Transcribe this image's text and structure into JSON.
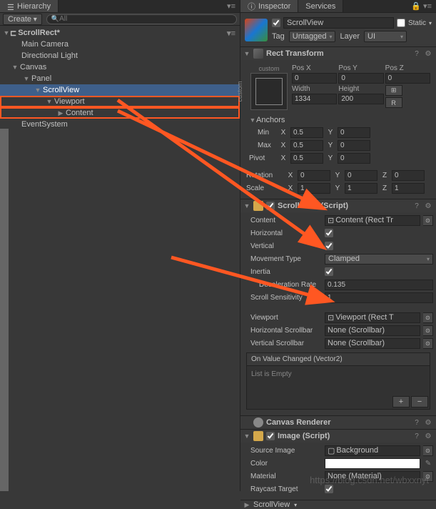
{
  "hierarchy": {
    "tab": "Hierarchy",
    "create": "Create",
    "search_placeholder": "All",
    "scene": "ScrollRect*",
    "items": {
      "main_camera": "Main Camera",
      "directional_light": "Directional Light",
      "canvas": "Canvas",
      "panel": "Panel",
      "scrollview": "ScrollView",
      "viewport": "Viewport",
      "content": "Content",
      "eventsystem": "EventSystem"
    }
  },
  "inspector": {
    "tab": "Inspector",
    "services_tab": "Services",
    "go_name": "ScrollView",
    "static_label": "Static",
    "tag_label": "Tag",
    "tag_value": "Untagged",
    "layer_label": "Layer",
    "layer_value": "UI"
  },
  "rect_transform": {
    "title": "Rect Transform",
    "anchor_preset_top": "custom",
    "anchor_preset_left": "custom",
    "labels": {
      "posx": "Pos X",
      "posy": "Pos Y",
      "posz": "Pos Z",
      "width": "Width",
      "height": "Height"
    },
    "posx": "0",
    "posy": "0",
    "posz": "0",
    "width": "1334",
    "height": "200",
    "blueprint": "⊞",
    "raw": "R",
    "anchors_label": "Anchors",
    "min_label": "Min",
    "max_label": "Max",
    "pivot_label": "Pivot",
    "min_x": "0.5",
    "min_y": "0",
    "max_x": "0.5",
    "max_y": "0",
    "pivot_x": "0.5",
    "pivot_y": "0",
    "rotation_label": "Rotation",
    "scale_label": "Scale",
    "rot_x": "0",
    "rot_y": "0",
    "rot_z": "0",
    "scale_x": "1",
    "scale_y": "1",
    "scale_z": "1"
  },
  "scroll_rect": {
    "title": "Scroll Rect (Script)",
    "content_label": "Content",
    "content_value": "Content (Rect Tr",
    "horizontal_label": "Horizontal",
    "vertical_label": "Vertical",
    "movement_label": "Movement Type",
    "movement_value": "Clamped",
    "inertia_label": "Inertia",
    "decel_label": "Deceleration Rate",
    "decel_value": "0.135",
    "sensitivity_label": "Scroll Sensitivity",
    "sensitivity_value": "1",
    "viewport_label": "Viewport",
    "viewport_value": "Viewport (Rect T",
    "hscroll_label": "Horizontal Scrollbar",
    "hscroll_value": "None (Scrollbar)",
    "vscroll_label": "Vertical Scrollbar",
    "vscroll_value": "None (Scrollbar)",
    "event_title": "On Value Changed (Vector2)",
    "event_empty": "List is Empty"
  },
  "canvas_renderer": {
    "title": "Canvas Renderer"
  },
  "image": {
    "title": "Image (Script)",
    "source_label": "Source Image",
    "source_value": "Background",
    "color_label": "Color",
    "material_label": "Material",
    "material_value": "None (Material)",
    "raycast_label": "Raycast Target"
  },
  "footer": {
    "scrollview_mat": "ScrollView"
  },
  "watermark": "https://blog.csdn.net/wbxxnyt"
}
